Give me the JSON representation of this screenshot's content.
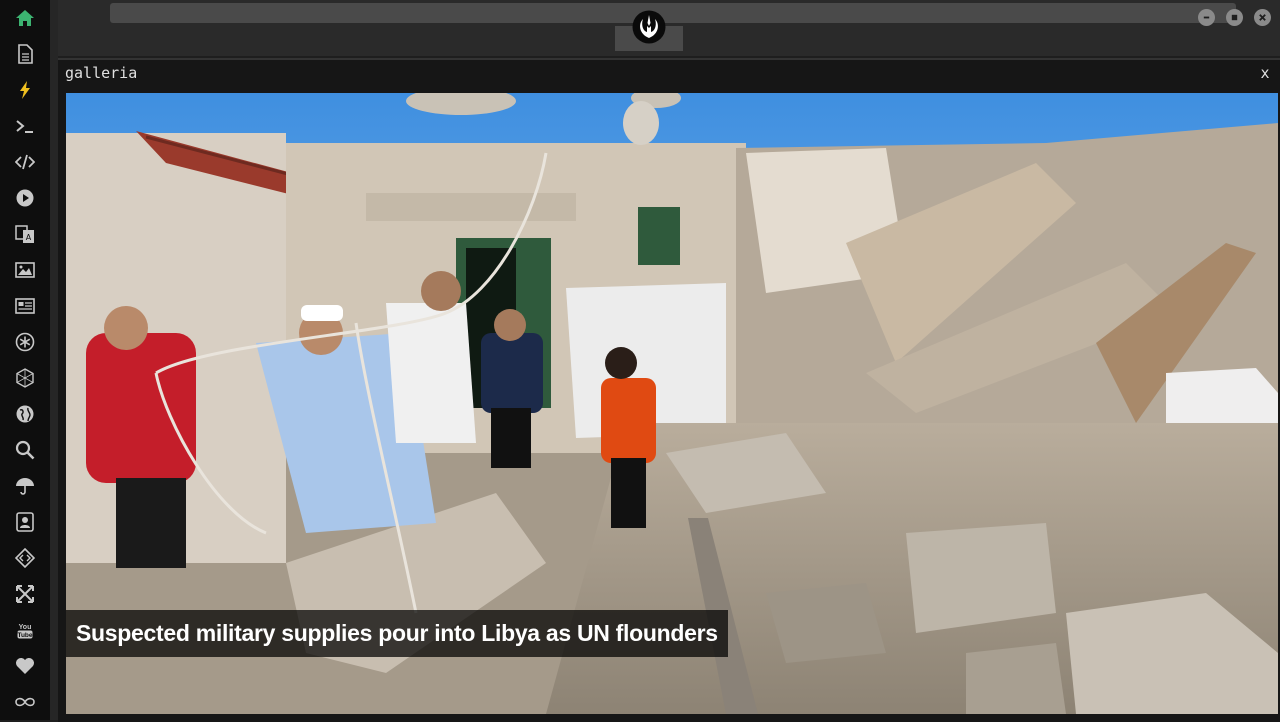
{
  "colors": {
    "accent_green": "#3cb371",
    "accent_yellow": "#f0c020",
    "sidebar_icon": "#c8c8c8"
  },
  "sidebar": {
    "items": [
      {
        "icon": "home-icon",
        "active": true
      },
      {
        "icon": "document-icon"
      },
      {
        "icon": "lightning-icon"
      },
      {
        "icon": "terminal-icon"
      },
      {
        "icon": "code-icon"
      },
      {
        "icon": "play-icon"
      },
      {
        "icon": "translate-icon"
      },
      {
        "icon": "image-icon"
      },
      {
        "icon": "news-icon"
      },
      {
        "icon": "asterisk-icon"
      },
      {
        "icon": "hexagon-icon"
      },
      {
        "icon": "globe-icon"
      },
      {
        "icon": "search-icon"
      },
      {
        "icon": "umbrella-icon"
      },
      {
        "icon": "contact-icon"
      },
      {
        "icon": "diamond-code-icon"
      },
      {
        "icon": "expand-icon"
      },
      {
        "icon": "youtube-icon"
      },
      {
        "icon": "heart-icon"
      },
      {
        "icon": "infinity-icon"
      }
    ]
  },
  "titlebar": {
    "logo_icon": "rebel-alliance-icon",
    "buttons": [
      "minimize-icon",
      "maximize-icon",
      "close-icon"
    ]
  },
  "panel": {
    "title": "galleria",
    "close_label": "x"
  },
  "gallery": {
    "caption": "Suspected military supplies pour into Libya as UN flounders"
  }
}
